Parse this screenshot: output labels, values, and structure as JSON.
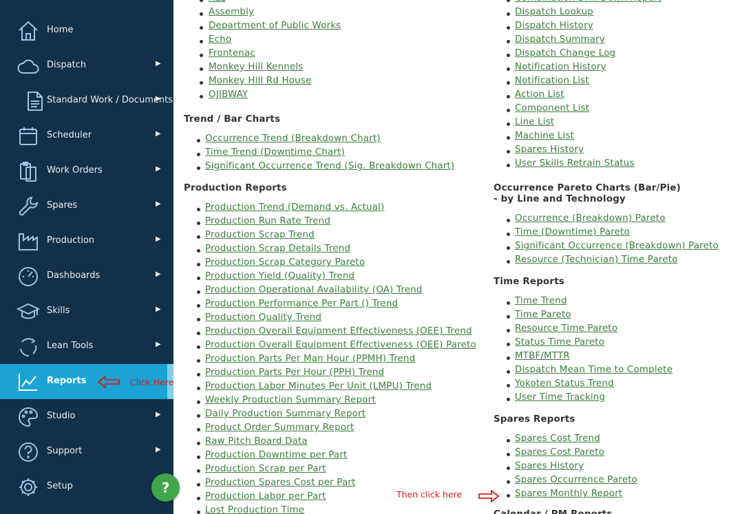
{
  "sidebar": {
    "items": [
      {
        "label": "Home",
        "icon": "home-icon"
      },
      {
        "label": "Dispatch",
        "icon": "cloud-icon"
      },
      {
        "label": "Standard Work / Documents",
        "icon": "document-icon"
      },
      {
        "label": "Scheduler",
        "icon": "calendar-icon"
      },
      {
        "label": "Work Orders",
        "icon": "clipboard-icon"
      },
      {
        "label": "Spares",
        "icon": "wrench-icon"
      },
      {
        "label": "Production",
        "icon": "factory-icon"
      },
      {
        "label": "Dashboards",
        "icon": "gauge-icon"
      },
      {
        "label": "Skills",
        "icon": "graduation-cap-icon"
      },
      {
        "label": "Lean Tools",
        "icon": "cycle-icon"
      },
      {
        "label": "Reports",
        "icon": "line-chart-icon"
      },
      {
        "label": "Studio",
        "icon": "palette-icon"
      },
      {
        "label": "Support",
        "icon": "question-circle-icon"
      },
      {
        "label": "Setup",
        "icon": "gear-icon"
      }
    ],
    "help_label": "?"
  },
  "left_column": {
    "top_links": [
      "ALL",
      "Assembly",
      "Department of Public Works",
      "Echo",
      "Frontenac",
      "Monkey Hill Kennels",
      "Monkey Hill Rd House",
      "OJIBWAY"
    ],
    "trend_heading": "Trend / Bar Charts",
    "trend_links": [
      "Occurrence Trend (Breakdown Chart)",
      "Time Trend (Downtime Chart)",
      "Significant Occurrence Trend (Sig. Breakdown Chart)"
    ],
    "production_heading": "Production Reports",
    "production_links": [
      "Production Trend (Demand vs. Actual)",
      "Production Run Rate Trend",
      "Production Scrap Trend",
      "Production Scrap Details Trend",
      "Production Scrap Category Pareto",
      "Production Yield (Quality) Trend",
      "Production Operational Availability (OA) Trend",
      "Production Performance Per Part () Trend",
      "Production Quality Trend",
      "Production Overall Equipment Effectiveness (OEE) Trend",
      "Production Overall Equipment Effectiveness (OEE) Pareto",
      "Production Parts Per Man Hour (PPMH) Trend",
      "Production Parts Per Hour (PPH) Trend",
      "Production Labor Minutes Per Unit (LMPU) Trend",
      "Weekly Production Summary Report",
      "Daily Production Summary Report",
      "Product Order Summary Report",
      "Raw Pitch Board Data",
      "Production Downtime per Part",
      "Production Scrap per Part",
      "Production Spares Cost per Part",
      "Production Labor per Part",
      "Lost Production Time"
    ]
  },
  "right_column": {
    "top_links": [
      "Combination Drill Down Report",
      "Dispatch Lookup",
      "Dispatch History",
      "Dispatch Summary",
      "Dispatch Change Log",
      "Notification History",
      "Notification List",
      "Action List",
      "Component List",
      "Line List",
      "Machine List",
      "Spares History",
      "User Skills Retrain Status"
    ],
    "pareto_heading_line1": "Occurrence Pareto Charts (Bar/Pie)",
    "pareto_heading_line2": "- by Line and Technology",
    "pareto_links": [
      "Occurrence (Breakdown) Pareto",
      "Time (Downtime) Pareto",
      "Significant Occurrence (Breakdown) Pareto",
      "Resource (Technician) Time Pareto"
    ],
    "time_heading": "Time Reports",
    "time_links": [
      "Time Trend",
      "Time Pareto",
      "Resource Time Pareto",
      "Status Time Pareto",
      "MTBF/MTTR",
      "Dispatch Mean Time to Complete",
      "Yokoten Status Trend",
      "User Time Tracking"
    ],
    "spares_heading": "Spares Reports",
    "spares_links": [
      "Spares Cost Trend",
      "Spares Cost Pareto",
      "Spares History",
      "Spares Occurrence Pareto",
      "Spares Monthly Report"
    ],
    "next_heading": "Calendar / PM Reports"
  },
  "annotations": {
    "click_here": "Click Here",
    "then_click_here": "Then click here",
    "color": "#d51d1d"
  },
  "colors": {
    "sidebar_bg": "#123049",
    "active_bg": "#1aa3d4",
    "link": "#3c7d3c",
    "help_button": "#3fa64a"
  }
}
